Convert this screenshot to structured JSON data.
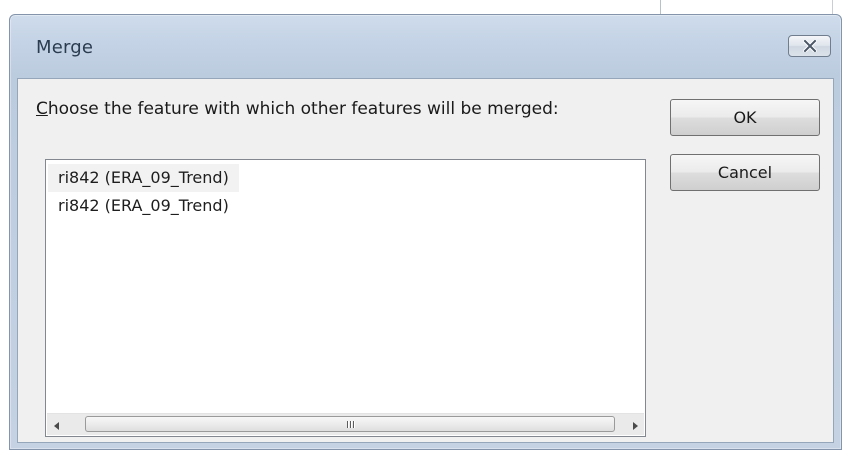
{
  "window": {
    "title": "Merge"
  },
  "dialog": {
    "prompt_mnemonic": "C",
    "prompt_rest": "hoose the feature with which other features will be merged:",
    "features": [
      {
        "label": "ri842 (ERA_09_Trend)",
        "selected": true
      },
      {
        "label": "ri842 (ERA_09_Trend)",
        "selected": false
      }
    ],
    "ok_label": "OK",
    "cancel_label": "Cancel"
  },
  "icons": {
    "close": "close-x-icon",
    "scroll_left": "triangle-left-icon",
    "scroll_right": "triangle-right-icon",
    "grip": "scroll-grip-icon"
  },
  "colors": {
    "title_bar": "#c5d4e6",
    "client_area": "#f0f0f0",
    "selection": "#f2f2f2"
  }
}
